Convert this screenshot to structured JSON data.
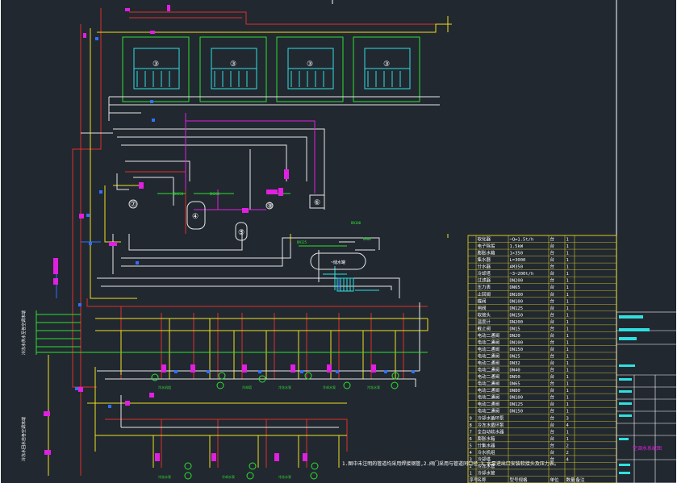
{
  "drawing": {
    "colors": {
      "background": "#212830",
      "frame": "#ffffff",
      "supply_red": "#e0302a",
      "return_yellow": "#f0e020",
      "white_pipe": "#e8e8e8",
      "magenta": "#e020e0",
      "cyan": "#30e0e0",
      "green": "#30e030",
      "blue": "#3070ff",
      "table_yellow": "#f0e020"
    },
    "cooling_tower_label": "③",
    "chiller_label": "④",
    "tank_label": "⑤",
    "pump_label": "⑥",
    "softener_label": "⑦",
    "unit_label": "①",
    "header_tank_label": "⑧",
    "left_supply_note": "冷冻水供水至各空调末端",
    "left_return_note": "冷冻水回水自各空调末端",
    "vessel_text": "~储水罐",
    "pipe_tags": [
      "DN150",
      "DN200",
      "DN100",
      "DN125",
      "DN80"
    ],
    "bottom_note": "1.图中未注明的管道均采用焊接钢管,2.阀门采用与管道同口径,3.水泵进出口安装软接头及压力表。",
    "equipment_captions": [
      "冷水机组",
      "冷却塔",
      "冷冻水泵",
      "冷却水泵"
    ]
  },
  "legend_table": {
    "rows": [
      {
        "no": "",
        "name": "软化器",
        "spec": "~Q=1.5t/h",
        "unit": "台",
        "qty": "1",
        "note": ""
      },
      {
        "no": "",
        "name": "电子除垢",
        "spec": "1.5kW",
        "unit": "台",
        "qty": "1",
        "note": ""
      },
      {
        "no": "",
        "name": "膨胀水箱",
        "spec": "1×350",
        "unit": "台",
        "qty": "1",
        "note": ""
      },
      {
        "no": "",
        "name": "集水器",
        "spec": "L=3000",
        "unit": "台",
        "qty": "1",
        "note": ""
      },
      {
        "no": "",
        "name": "分水器",
        "spec": "AM350",
        "unit": "台",
        "qty": "1",
        "note": ""
      },
      {
        "no": "",
        "name": "冷却塔",
        "spec": "~3~200t/h",
        "unit": "台",
        "qty": "1",
        "note": ""
      },
      {
        "no": "",
        "name": "过滤器",
        "spec": "DN200",
        "unit": "台",
        "qty": "1",
        "note": ""
      },
      {
        "no": "",
        "name": "压力表",
        "spec": "DN65",
        "unit": "台",
        "qty": "1",
        "note": ""
      },
      {
        "no": "",
        "name": "止回阀",
        "spec": "DN100",
        "unit": "台",
        "qty": "1",
        "note": ""
      },
      {
        "no": "",
        "name": "蝶阀",
        "spec": "DN100",
        "unit": "台",
        "qty": "1",
        "note": ""
      },
      {
        "no": "",
        "name": "闸阀",
        "spec": "DN125",
        "unit": "台",
        "qty": "1",
        "note": ""
      },
      {
        "no": "",
        "name": "软接头",
        "spec": "DN150",
        "unit": "台",
        "qty": "1",
        "note": ""
      },
      {
        "no": "",
        "name": "温度计",
        "spec": "DN200",
        "unit": "台",
        "qty": "1",
        "note": ""
      },
      {
        "no": "",
        "name": "截止阀",
        "spec": "DN15",
        "unit": "台",
        "qty": "1",
        "note": ""
      },
      {
        "no": "",
        "name": "电动二通阀",
        "spec": "DN20",
        "unit": "台",
        "qty": "1",
        "note": ""
      },
      {
        "no": "",
        "name": "电动二通阀",
        "spec": "DN100",
        "unit": "台",
        "qty": "1",
        "note": ""
      },
      {
        "no": "",
        "name": "电动二通阀",
        "spec": "DN150",
        "unit": "台",
        "qty": "1",
        "note": ""
      },
      {
        "no": "",
        "name": "电动二通阀",
        "spec": "DN25",
        "unit": "台",
        "qty": "1",
        "note": ""
      },
      {
        "no": "",
        "name": "电动二通阀",
        "spec": "DN32",
        "unit": "台",
        "qty": "1",
        "note": ""
      },
      {
        "no": "",
        "name": "电动二通阀",
        "spec": "DN40",
        "unit": "台",
        "qty": "1",
        "note": ""
      },
      {
        "no": "",
        "name": "电动二通阀",
        "spec": "DN50",
        "unit": "台",
        "qty": "1",
        "note": ""
      },
      {
        "no": "",
        "name": "电动二通阀",
        "spec": "DN65",
        "unit": "台",
        "qty": "1",
        "note": ""
      },
      {
        "no": "",
        "name": "电动二通阀",
        "spec": "DN80",
        "unit": "台",
        "qty": "1",
        "note": ""
      },
      {
        "no": "",
        "name": "电动二通阀",
        "spec": "DN100",
        "unit": "台",
        "qty": "1",
        "note": ""
      },
      {
        "no": "",
        "name": "电动二通阀",
        "spec": "DN125",
        "unit": "台",
        "qty": "1",
        "note": ""
      },
      {
        "no": "",
        "name": "电动二通阀",
        "spec": "DN150",
        "unit": "台",
        "qty": "1",
        "note": ""
      },
      {
        "no": "9",
        "name": "冷却水循环泵",
        "spec": "",
        "unit": "台",
        "qty": "3",
        "note": ""
      },
      {
        "no": "8",
        "name": "冷冻水循环泵",
        "spec": "",
        "unit": "台",
        "qty": "4",
        "note": ""
      },
      {
        "no": "7",
        "name": "全自动软水器",
        "spec": "",
        "unit": "台",
        "qty": "1",
        "note": ""
      },
      {
        "no": "6",
        "name": "膨胀水箱",
        "spec": "",
        "unit": "台",
        "qty": "1",
        "note": ""
      },
      {
        "no": "5",
        "name": "分集水器",
        "spec": "",
        "unit": "台",
        "qty": "2",
        "note": ""
      },
      {
        "no": "4",
        "name": "冷水机组",
        "spec": "",
        "unit": "台",
        "qty": "2",
        "note": ""
      },
      {
        "no": "3",
        "name": "冷却塔",
        "spec": "",
        "unit": "台",
        "qty": "4",
        "note": ""
      },
      {
        "no": "2",
        "name": "冷冻水管",
        "spec": "",
        "unit": "",
        "qty": "",
        "note": ""
      },
      {
        "no": "1",
        "name": "冷却水管",
        "spec": "",
        "unit": "",
        "qty": "",
        "note": ""
      }
    ],
    "header": {
      "no": "序号",
      "name": "名称",
      "spec": "型号规格",
      "unit": "单位",
      "qty": "数量",
      "note": "备注"
    }
  },
  "title_block": {
    "drawing_title": "空调水系统图"
  }
}
